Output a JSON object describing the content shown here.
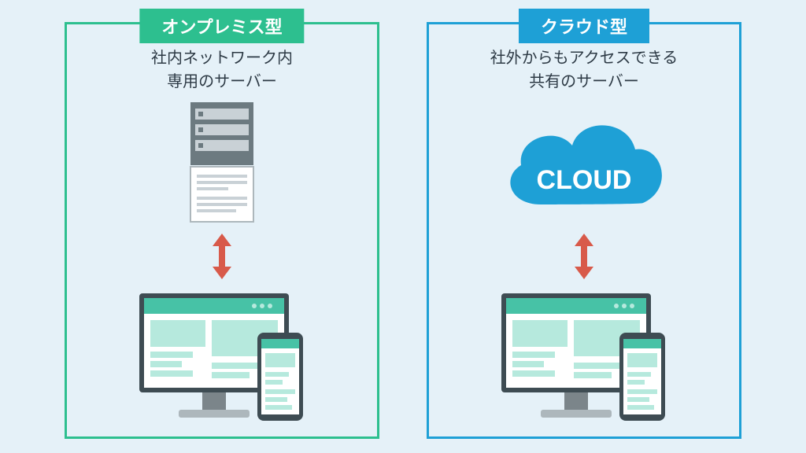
{
  "onprem": {
    "title": "オンプレミス型",
    "desc_line1": "社内ネットワーク内",
    "desc_line2": "専用のサーバー",
    "accent": "#2dbf8f"
  },
  "cloud": {
    "title": "クラウド型",
    "desc_line1": "社外からもアクセスできる",
    "desc_line2": "共有のサーバー",
    "cloud_label": "CLOUD",
    "accent": "#1ea0d6"
  },
  "colors": {
    "arrow": "#d85a4a",
    "server_gray": "#6c7a80",
    "server_slot": "#c9d1d6",
    "device_frame": "#3e4c53",
    "device_fill": "#ffffff",
    "ui_teal": "#b6e9dd",
    "ui_teal_dark": "#47c2a6"
  }
}
